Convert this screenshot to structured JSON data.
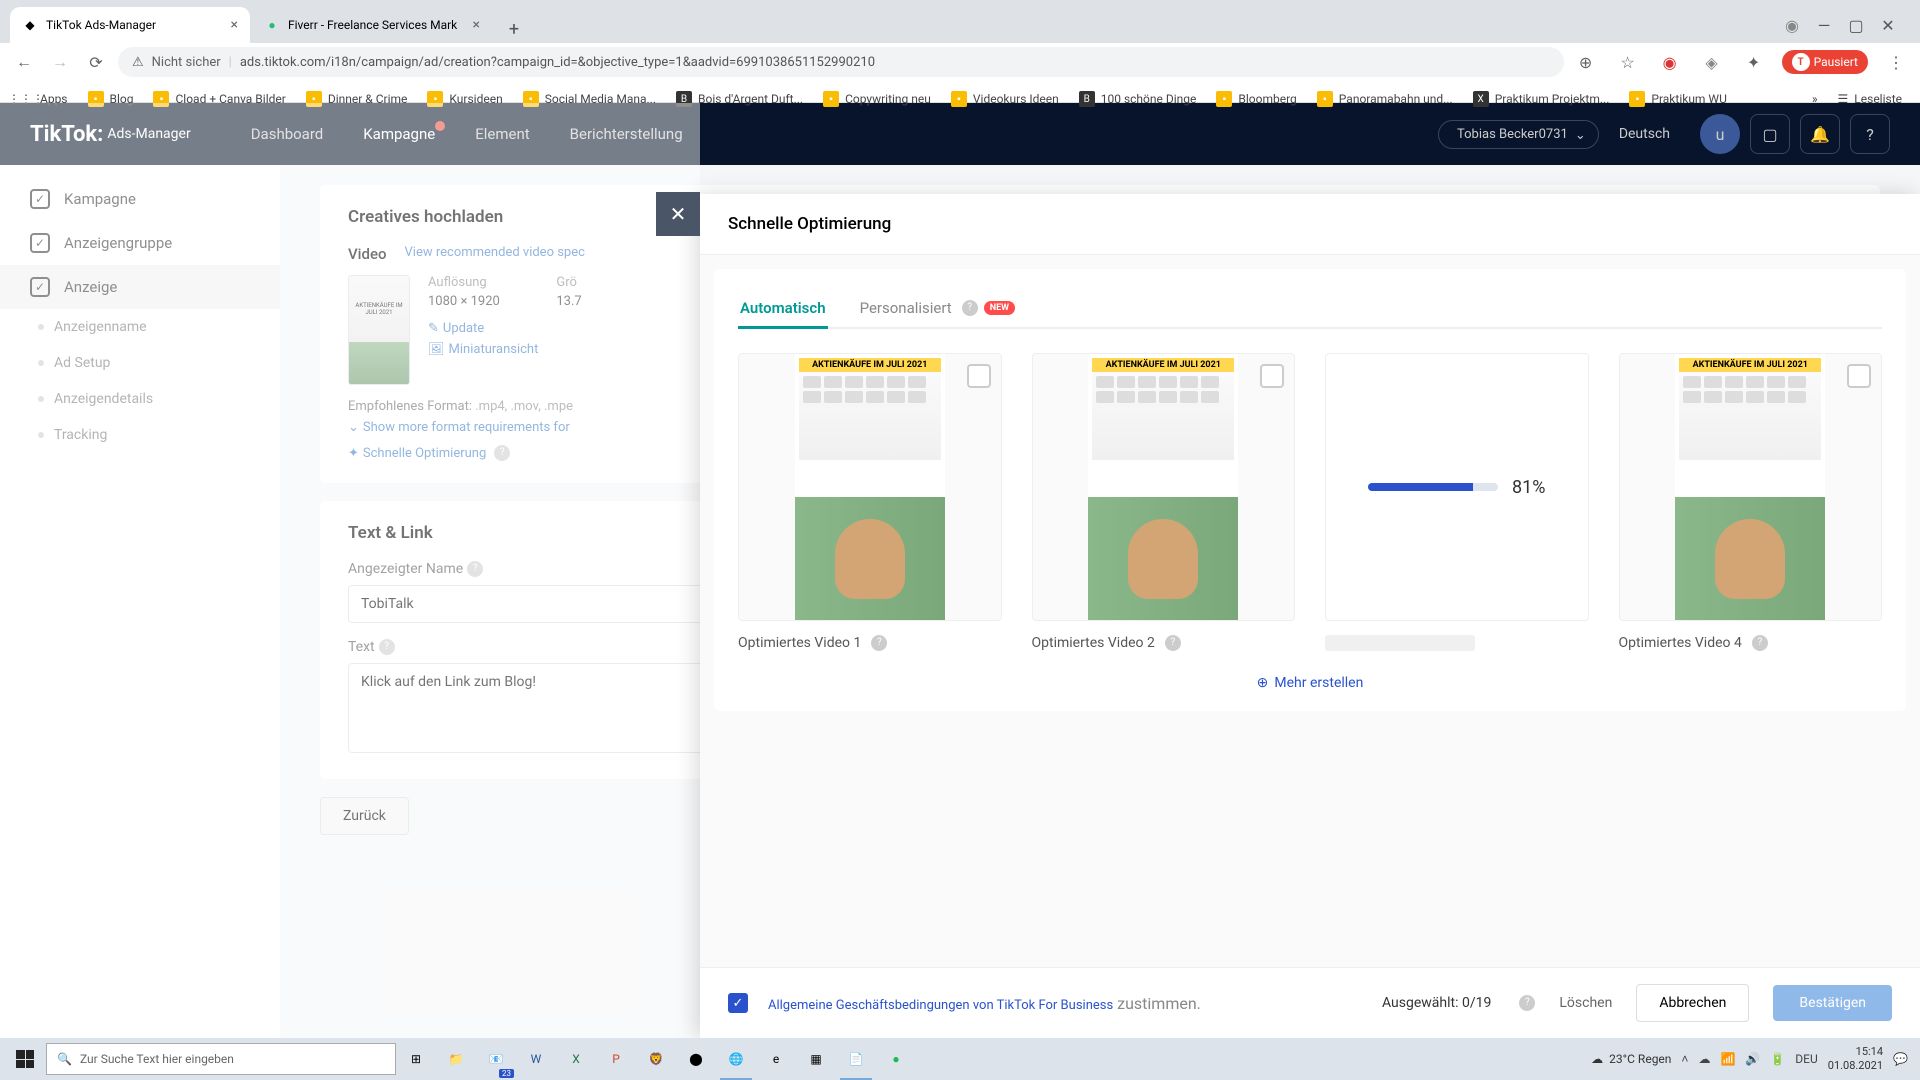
{
  "browser": {
    "tabs": [
      {
        "title": "TikTok Ads-Manager",
        "active": true
      },
      {
        "title": "Fiverr - Freelance Services Mark",
        "active": false
      }
    ],
    "url_warning": "Nicht sicher",
    "url": "ads.tiktok.com/i18n/campaign/ad/creation?campaign_id=&objective_type=1&aadvid=6991038651152990210",
    "profile_status": "Pausiert",
    "bookmarks": [
      "Apps",
      "Blog",
      "Cload + Canva Bilder",
      "Dinner & Crime",
      "Kursideen",
      "Social Media Mana...",
      "Bois d'Argent Duft...",
      "Copywriting neu",
      "Videokurs Ideen",
      "100 schöne Dinge",
      "Bloomberg",
      "Panoramabahn und...",
      "Praktikum Projektm...",
      "Praktikum WU"
    ],
    "reading_list": "Leseliste"
  },
  "header": {
    "logo": "TikTok:",
    "logo_sub": "Ads-Manager",
    "nav": [
      "Dashboard",
      "Kampagne",
      "Element",
      "Berichterstellung"
    ],
    "user": "Tobias Becker0731",
    "language": "Deutsch"
  },
  "sidebar": {
    "main": [
      "Kampagne",
      "Anzeigengruppe",
      "Anzeige"
    ],
    "subs": [
      "Anzeigenname",
      "Ad Setup",
      "Anzeigendetails",
      "Tracking"
    ]
  },
  "content": {
    "upload_title": "Creatives hochladen",
    "video_label": "Video",
    "view_spec": "View recommended video spec",
    "thumb_title": "AKTIENKÄUFE IM JULI 2021",
    "resolution_label": "Auflösung",
    "resolution": "1080 × 1920",
    "size_label": "Grö",
    "size": "13.7",
    "update": "Update",
    "miniature": "Miniaturansicht",
    "format_label": "Empfohlenes Format:",
    "formats": ".mp4, .mov, .mpe",
    "show_more": "Show more format requirements for",
    "quick_opt": "Schnelle Optimierung",
    "text_link_title": "Text & Link",
    "display_name_label": "Angezeigter Name",
    "display_name": "TobiTalk",
    "text_label": "Text",
    "text_value": "Klick auf den Link zum Blog!",
    "back": "Zurück"
  },
  "modal": {
    "title": "Schnelle Optimierung",
    "tab_auto": "Automatisch",
    "tab_personal": "Personalisiert",
    "new_badge": "NEW",
    "thumbnail_text": "AKTIENKÄUFE IM JULI 2021",
    "videos": [
      {
        "label": "Optimiertes Video 1"
      },
      {
        "label": "Optimiertes Video 2"
      },
      {
        "label": "",
        "loading": true,
        "progress": "81%"
      },
      {
        "label": "Optimiertes Video 4"
      }
    ],
    "more": "Mehr erstellen",
    "agb": "Allgemeine Geschäftsbedingungen von TikTok For Business",
    "agb_suffix": "zustimmen.",
    "selected": "Ausgewählt: 0/19",
    "delete": "Löschen",
    "cancel": "Abbrechen",
    "confirm": "Bestätigen"
  },
  "taskbar": {
    "search": "Zur Suche Text hier eingeben",
    "weather": "23°C Regen",
    "lang": "DEU",
    "time": "15:14",
    "date": "01.08.2021",
    "mail_badge": "23"
  }
}
